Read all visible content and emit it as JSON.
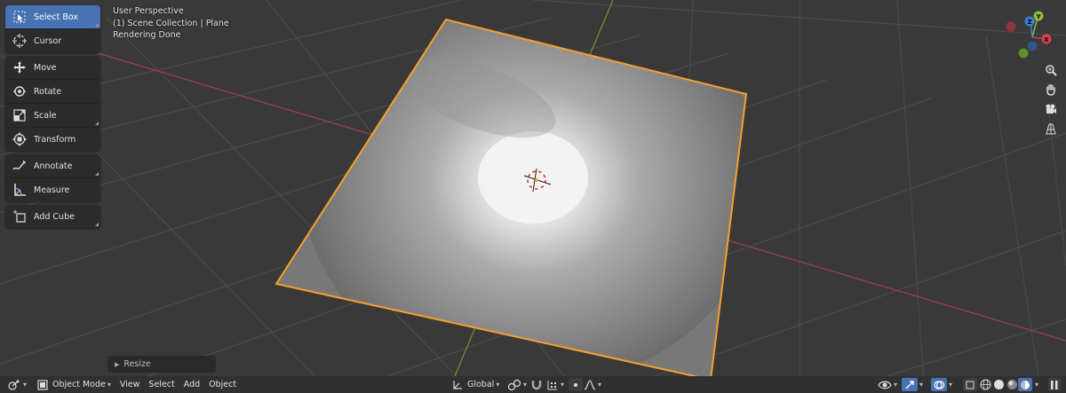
{
  "viewport": {
    "overlay": {
      "perspective": "User Perspective",
      "collection": "(1) Scene Collection | Plane",
      "status": "Rendering Done"
    },
    "colors": {
      "background": "#393939",
      "grid": "#4a4a4a",
      "x_axis": "#a0404a",
      "y_axis": "#6a9a2a",
      "selection_outline": "#f5a030"
    },
    "gizmo": {
      "x": "X",
      "y": "Y",
      "z": "Z"
    }
  },
  "toolbar": {
    "groups": [
      [
        {
          "label": "Select Box",
          "icon": "select-box-icon",
          "active": true
        },
        {
          "label": "Cursor",
          "icon": "cursor-icon"
        }
      ],
      [
        {
          "label": "Move",
          "icon": "move-icon"
        },
        {
          "label": "Rotate",
          "icon": "rotate-icon"
        },
        {
          "label": "Scale",
          "icon": "scale-icon"
        },
        {
          "label": "Transform",
          "icon": "transform-icon"
        }
      ],
      [
        {
          "label": "Annotate",
          "icon": "annotate-icon"
        },
        {
          "label": "Measure",
          "icon": "measure-icon"
        }
      ],
      [
        {
          "label": "Add Cube",
          "icon": "add-cube-icon"
        }
      ]
    ]
  },
  "last_operation": {
    "label": "Resize"
  },
  "header": {
    "mode": "Object Mode",
    "menus": [
      "View",
      "Select",
      "Add",
      "Object"
    ],
    "orientation": "Global"
  }
}
